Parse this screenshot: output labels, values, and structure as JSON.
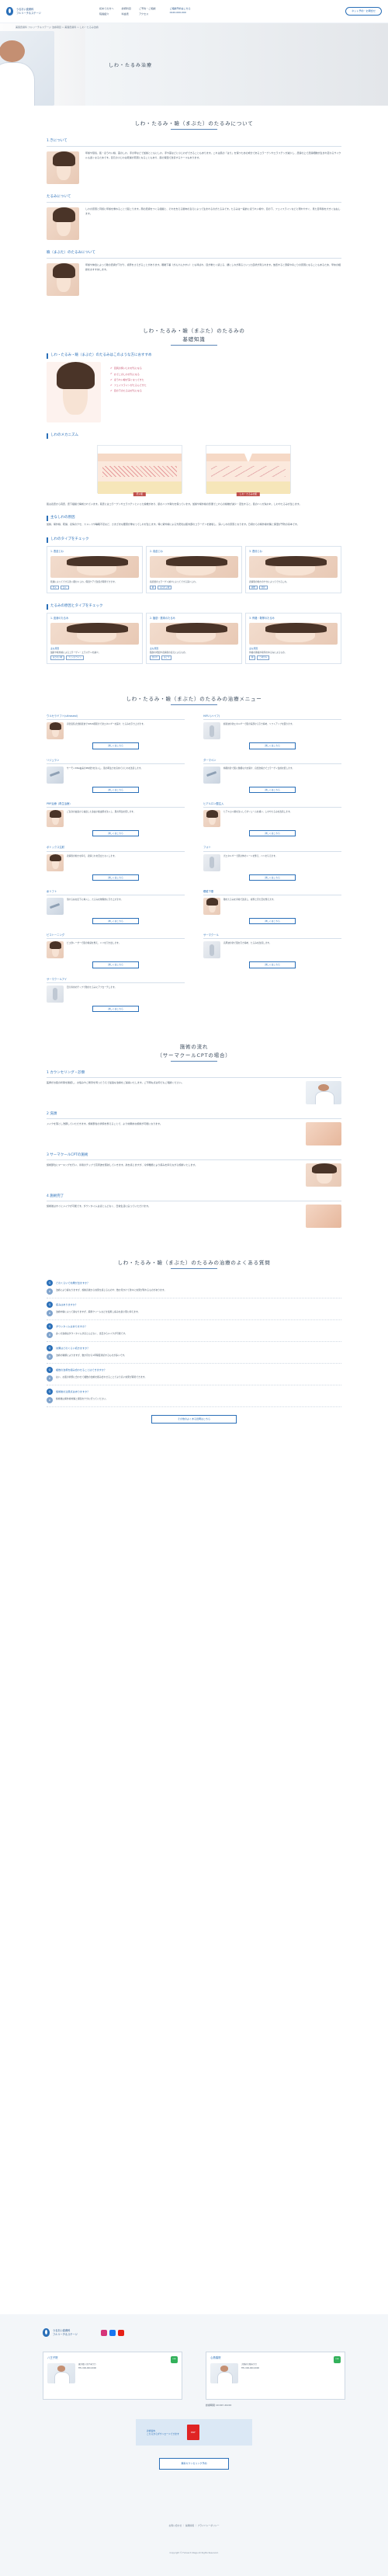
{
  "header": {
    "logo_line1": "うるおい皮膚科",
    "logo_line2": "フルリーチ＆ステージ",
    "nav": [
      [
        "初めての方へ",
        "院長紹介"
      ],
      [
        "診療科目",
        "料金表"
      ],
      [
        "ご予約・ご相談",
        "アクセス"
      ]
    ],
    "phone_label": "ご相談予約はこちら",
    "phone": "0120-000-000",
    "reserve_label": "ネット予約・お問合せ"
  },
  "hero": {
    "breadcrumb": "美容皮膚科 フルリーチ＆ステージ 治療項目 > 美容皮膚科 > しわ・たるみ治療",
    "title": "しわ・たるみ治療"
  },
  "about": {
    "title": "しわ・たるみ・瞼（まぶた）のたるみについて",
    "items": [
      {
        "heading": "1.きについて",
        "text": "年齢や環境、肌・ほうれい線、首のしわ、手の甲などで加齢とともにしわ、手や首などに小じわができることもあります。これは肌の「はり」を保つための成分であるコラーゲンやエラスチンが減少し、皮膚の上で皮膚細胞が生まれ変わるサイクルも遅くなるためです。目元の小じわは乾燥が原因となることもあり、肌の保湿で改善するケースもあります。"
      },
      {
        "heading": "たるみについて",
        "text": "しわの原因と同様に年齢を重ねることで起こります。顔の皮膚をつくる組織と、それを支える筋肉の衰えによって生まれるのがたるみです。たるみは一般的にほうれい線や、目の下、フェイスラインなどに現れやすく、見た目年齢を大きく左右します。"
      },
      {
        "heading": "瞼（まぶた）のたるみについて",
        "text": "年齢や体質によって瞼の皮膚が下がり、視界をさえぎることがあります。眼瞼下垂（がんけんかすい）とも呼ばれ、目が重たく感じる、額にしわが寄るといった症状が見られます。放置すると頭痛や肩こりの原因になることもあるため、早めの相談をおすすめします。"
      }
    ]
  },
  "basics": {
    "title_line1": "しわ・たるみ・瞼（まぶた）のたるみの",
    "title_line2": "基礎知識",
    "check_heading": "しわ・たるみ・瞼（まぶた）のたるみはこのような方におすすめ",
    "check_items": [
      "目尻の笑いじわが気になる",
      "おでこのしわが気になる",
      "ほうれい線が深くなってきた",
      "フェイスラインがたるんできた",
      "目の下のたるみが気になる"
    ],
    "mechanism_heading": "しわのメカニズム",
    "mechanism_labels": [
      "若い肌",
      "しわ・たるみの肌"
    ],
    "mechanism_text": "肌は表皮から真皮、皮下組織で構成されています。真皮にはコラーゲンやエラスチンといった線維があり、肌のハリや弾力を保っています。加齢や紫外線の影響でこれらの線維が減少・変性すると、肌のハリが失われ、しわやたるみが生じます。",
    "cause_heading": "主なしわの原因",
    "cause_text": "加齢、紫外線、乾燥、表情のクセ、ストレスや睡眠不足など、さまざまな要因が重なってしわが生じます。特に紫外線による光老化は肌内部のコラーゲンを破壊し、深いしわの原因となります。日頃からの紫外線対策と保湿が予防の基本です。",
    "types_heading": "しわのタイプをチェック",
    "types": [
      {
        "title": "1. 表皮じわ",
        "note": "乾燥によってできる浅く細かいしわ。保湿ケアで改善が期待できます。",
        "tags": [
          "目元",
          "口元"
        ]
      },
      {
        "title": "2. 真皮じわ",
        "note": "真皮層のコラーゲン減少によってできる深いしわ。",
        "tags": [
          "額",
          "ほうれい線"
        ]
      },
      {
        "title": "3. 表情じわ",
        "note": "表情筋の動きのクセによってできるしわ。",
        "tags": [
          "眉間",
          "目尻"
        ]
      }
    ],
    "sag_heading": "たるみの原因とタイプをチェック",
    "sag_types": [
      {
        "title": "1. 皮膚のたるみ",
        "sub": "主な原因",
        "note": "加齢や紫外線によるコラーゲン・エラスチンの減少。",
        "tags": [
          "ほうれい線",
          "フェイスライン"
        ]
      },
      {
        "title": "2. 脂肪・筋肉のたるみ",
        "sub": "主な原因",
        "note": "脂肪の増加や表情筋の衰えによるもの。",
        "tags": [
          "目の下",
          "あご下"
        ]
      },
      {
        "title": "3. 骨格・靭帯のたるみ",
        "sub": "主な原因",
        "note": "骨格の萎縮や靭帯のゆるみによるもの。",
        "tags": [
          "頬",
          "こめかみ"
        ]
      }
    ]
  },
  "treatments": {
    "title": "しわ・たるみ・瞼（まぶた）のたるみの治療メニュー",
    "more_label": "詳しくはこちら",
    "items": [
      {
        "name": "ウルセラドフト(ultraseal)",
        "text": "高密度焦点式超音波でSMAS筋膜まで熱エネルギーを届け、たるみを引き上げます。"
      },
      {
        "name": "HIFU (ハイフ)",
        "text": "超音波の熱エネルギーで肌の深部から引き締め、リフトアップを図ります。"
      },
      {
        "name": "リジュラン",
        "text": "サーモンDNA由来のPN成分を注入し、肌の再生力を高めて小じわを改善します。"
      },
      {
        "name": "ダーマペン",
        "text": "極細の針で肌に微細な穴を開け、自然治癒力でコラーゲン生成を促します。"
      },
      {
        "name": "PRP治療（再生治療）",
        "text": "ご自身の血液から抽出した多血小板血漿を注入し、肌の再生を促します。"
      },
      {
        "name": "ヒアルロン酸注入",
        "text": "ヒアルロン酸を注入してボリュームを補い、しわやたるみを改善します。"
      },
      {
        "name": "ボトックス注射",
        "text": "表情筋の動きを抑え、表情じわを目立たなくします。"
      },
      {
        "name": "フォト",
        "text": "光エネルギーで肌全体のトーンを整え、ハリを与えます。"
      },
      {
        "name": "糸リフト",
        "text": "溶ける糸を皮下に挿入し、たるみを物理的に引き上げます。"
      },
      {
        "name": "眼瞼下垂",
        "text": "瞼のたるみを手術で改善し、視界と見た目を整えます。"
      },
      {
        "name": "ピコトーニング",
        "text": "ピコ秒レーザーで肌の質感を整え、ハリを引き出します。"
      },
      {
        "name": "サーマクール",
        "text": "高周波の熱で肌を引き締め、たるみを改善します。"
      },
      {
        "name": "サーマクールアイ",
        "text": "目元専用のチップで瞼のたるみにアプローチします。"
      }
    ]
  },
  "flow": {
    "title_line1": "施術の流れ",
    "title_line2": "（サーマクールCPTの場合）",
    "steps": [
      {
        "title": "1 カウンセリング・診察",
        "text": "医師がお肌の状態を確認し、お悩みやご希望を伺ったうえで最適な治療をご提案いたします。ご不明な点は何でもご相談ください。"
      },
      {
        "title": "2 洗顔",
        "text": "メイクを落とし洗顔していただきます。施術部位の状態を整えることで、より効果的な施術が可能になります。"
      },
      {
        "title": "3 サーマクールCPTの施術",
        "text": "施術部位にマーキングを行い、専用のチップで高周波を照射していきます。熱を感じますが、冷却機能により痛みを抑えながら施術いたします。"
      },
      {
        "title": "4 施術完了",
        "text": "施術後はすぐにメイクが可能です。ダウンタイムはほとんどなく、日常生活に戻っていただけます。"
      }
    ]
  },
  "faq": {
    "title": "しわ・たるみ・瞼（まぶた）のたるみの治療のよくある質問",
    "items": [
      {
        "q": "どのくらいで効果が出ますか？",
        "a": "治療により異なりますが、施術直後から効果を感じるものや、数か月かけて徐々に効果が現れるものがあります。"
      },
      {
        "q": "痛みはありますか？",
        "a": "治療内容によって異なりますが、麻酔クリームなどを使用し痛みを最小限に抑えます。"
      },
      {
        "q": "ダウンタイムはありますか？",
        "a": "多くの治療はダウンタイムがほとんどなく、当日からメイクが可能です。"
      },
      {
        "q": "効果はどのくらい続きますか？",
        "a": "治療の種類によりますが、数か月から1年程度持続するものが多いです。"
      },
      {
        "q": "複数の治療を組み合わせることはできますか？",
        "a": "はい、お肌の状態に合わせて複数の治療を組み合わせることでより高い効果が期待できます。"
      },
      {
        "q": "施術後の注意点はありますか？",
        "a": "施術後は紫外線対策と保湿を十分に行ってください。"
      }
    ],
    "more_label": "その他のよくある質問はこちら"
  },
  "footer": {
    "logo_line1": "うるおい皮膚科",
    "logo_line2": "フルリーチ＆ステージ",
    "clinics": [
      {
        "name": "八王子院",
        "address": "東京都八王子市〇〇",
        "tel": "TEL 000-000-0000"
      },
      {
        "name": "心斎橋院",
        "address": "大阪府大阪市〇〇",
        "tel": "TEL 000-000-0000"
      }
    ],
    "hours": "診療時間 10:00〜19:00",
    "pdf_text_line1": "診療案内",
    "pdf_text_line2": "こちらからダウンロードできます",
    "counsel_btn": "無料カウンセリング予約",
    "bottom_links": "お問い合わせ ｜ 採用情報 ｜ プライバシーポリシー",
    "copyright": "Copyright © Fulreach Stage All Rights Reserved."
  }
}
